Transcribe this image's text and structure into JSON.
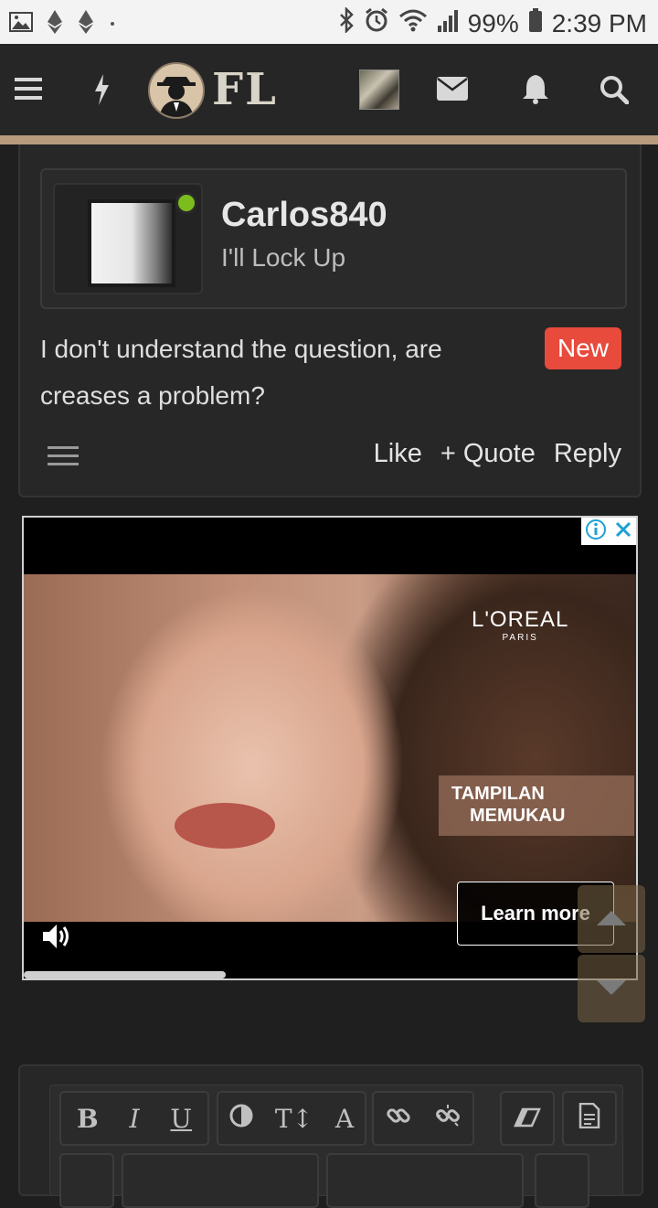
{
  "status_bar": {
    "battery": "99%",
    "time": "2:39 PM"
  },
  "navbar": {
    "logo_text": "FL"
  },
  "post": {
    "username": "Carlos840",
    "user_title": "I'll Lock Up",
    "body": "I don't understand the question, are creases a problem?",
    "badge": "New",
    "actions": {
      "like": "Like",
      "quote": "+ Quote",
      "reply": "Reply"
    }
  },
  "ad": {
    "brand": "L'OREAL",
    "brand_sub": "PARIS",
    "tagline_line1": "TAMPILAN",
    "tagline_line2": "MEMUKAU",
    "cta": "Learn more",
    "progress": 0.33
  },
  "editor": {
    "bold": "B",
    "italic": "I",
    "underline": "U",
    "text_size": "T↕",
    "font": "A"
  }
}
